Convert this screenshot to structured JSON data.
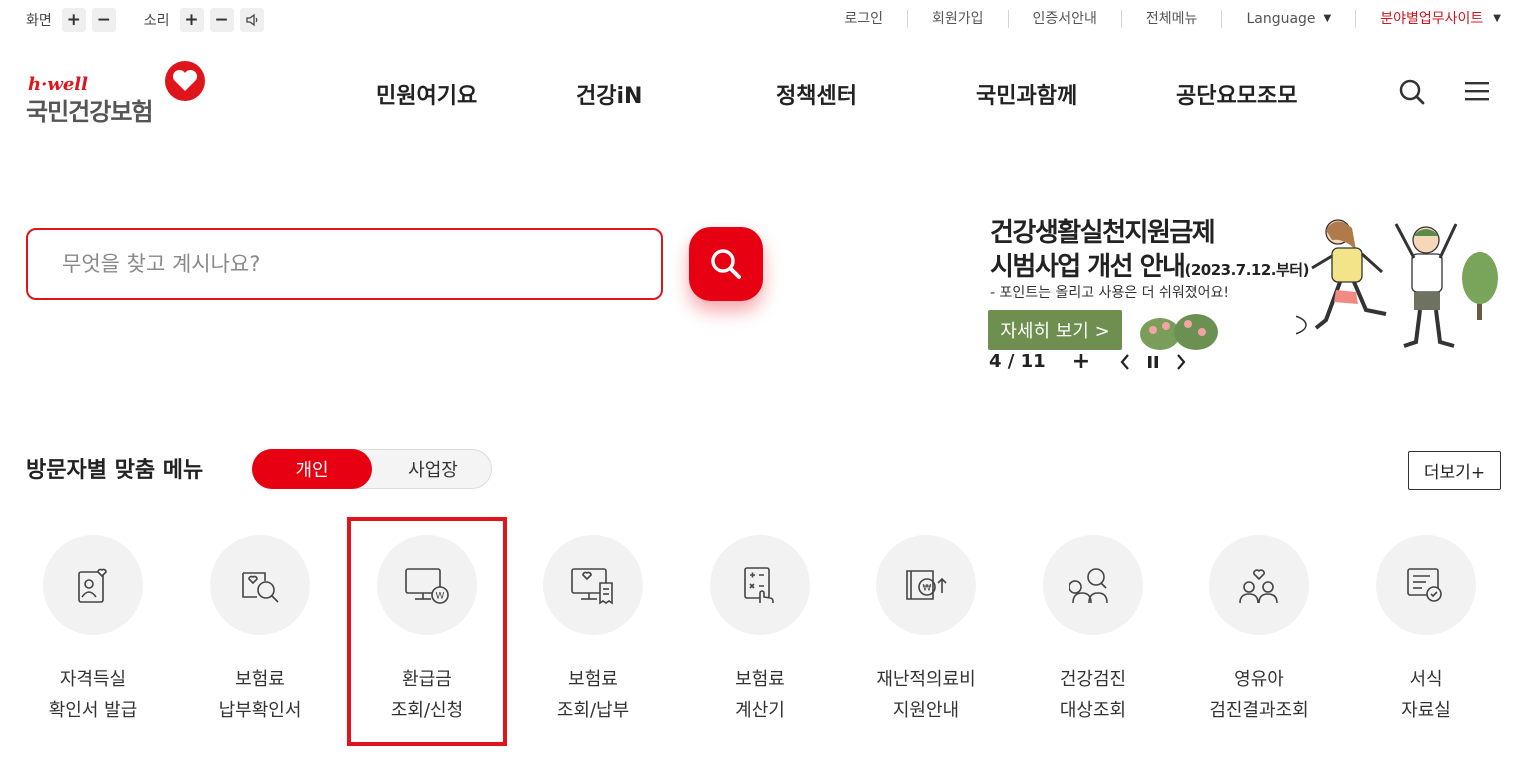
{
  "utility": {
    "screen_label": "화면",
    "sound_label": "소리",
    "links": [
      "로그인",
      "회원가입",
      "인증서안내",
      "전체메뉴"
    ],
    "language": "Language",
    "family_site": "분야별업무사이트"
  },
  "logo": {
    "brand": "h·well",
    "name": "국민건강보험"
  },
  "gnb": [
    "민원여기요",
    "건강iN",
    "정책센터",
    "국민과함께",
    "공단요모조모"
  ],
  "search": {
    "placeholder": "무엇을 찾고 계시나요?"
  },
  "banner": {
    "title_line1": "건강생활실천지원금제",
    "title_line2": "시범사업 개선 안내",
    "title_date": "(2023.7.12.부터)",
    "subtitle": "- 포인트는 올리고 사용은 더 쉬워졌어요!",
    "button": "자세히 보기 >",
    "current": "4",
    "total": "11",
    "counter_sep": " / "
  },
  "section": {
    "title": "방문자별 맞춤 메뉴",
    "toggle": [
      "개인",
      "사업장"
    ],
    "toggle_active": "개인",
    "more": "더보기+"
  },
  "menu": [
    {
      "line1": "자격득실",
      "line2": "확인서 발급",
      "icon": "id-card-heart-icon"
    },
    {
      "line1": "보험료",
      "line2": "납부확인서",
      "icon": "heart-magnifier-icon"
    },
    {
      "line1": "환급금",
      "line2": "조회/신청",
      "icon": "monitor-won-icon"
    },
    {
      "line1": "보험료",
      "line2": "조회/납부",
      "icon": "monitor-receipt-icon"
    },
    {
      "line1": "보험료",
      "line2": "계산기",
      "icon": "calculator-hand-icon"
    },
    {
      "line1": "재난적의료비",
      "line2": "지원안내",
      "icon": "book-won-icon"
    },
    {
      "line1": "건강검진",
      "line2": "대상조회",
      "icon": "people-search-icon"
    },
    {
      "line1": "영유아",
      "line2": "검진결과조회",
      "icon": "family-heart-icon"
    },
    {
      "line1": "서식",
      "line2": "자료실",
      "icon": "document-check-icon"
    }
  ],
  "colors": {
    "accent": "#e60012",
    "banner_button": "#6e8f4f",
    "highlight": "#e0151c"
  }
}
